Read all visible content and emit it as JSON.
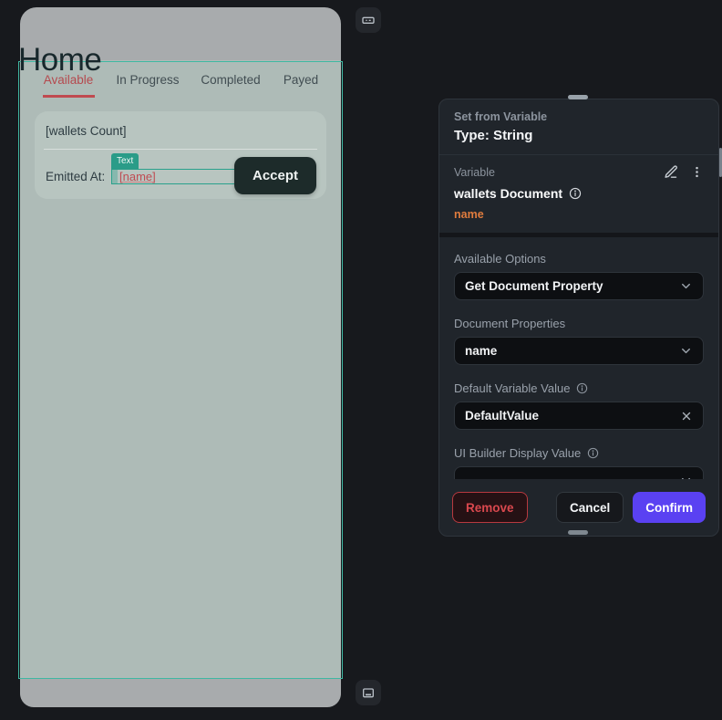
{
  "phone_preview": {
    "page_title": "Home",
    "tabs": [
      {
        "label": "Available",
        "active": true
      },
      {
        "label": "In Progress",
        "active": false
      },
      {
        "label": "Completed",
        "active": false
      },
      {
        "label": "Payed",
        "active": false
      }
    ],
    "card": {
      "count_text": "[wallets Count]",
      "emitted_label": "Emitted At:",
      "selection_badge": "Text",
      "selected_text_value": "[name]",
      "accept_button": "Accept"
    }
  },
  "canvas_toolbar": {
    "top_button_icon": "keyboard-icon",
    "bottom_button_icon": "dock-bottom-icon"
  },
  "panel": {
    "header": {
      "title": "Set from Variable",
      "subtitle": "Type: String"
    },
    "variable": {
      "label": "Variable",
      "name": "wallets Document",
      "property": "name",
      "icons": [
        "edit-pencil-icon",
        "kebab-menu-icon",
        "info-icon"
      ]
    },
    "groups": [
      {
        "label": "Available Options",
        "value": "Get Document Property",
        "type": "select",
        "info": false
      },
      {
        "label": "Document Properties",
        "value": "name",
        "type": "select",
        "info": false
      },
      {
        "label": "Default Variable Value",
        "value": "DefaultValue",
        "type": "input",
        "info": true
      },
      {
        "label": "UI Builder Display Value",
        "value": "",
        "type": "select",
        "info": true
      }
    ],
    "footer": {
      "remove": "Remove",
      "cancel": "Cancel",
      "confirm": "Confirm"
    }
  },
  "colors": {
    "page_bg": "#17191d",
    "phone_bar": "#a8abad",
    "phone_body": "#aebbb7",
    "card_bg": "#b8c5c0",
    "selection_teal": "#2aa18c",
    "tab_active_red": "#b5494e",
    "accept_dark": "#1d2b2a",
    "panel_bg": "#20252b",
    "control_bg": "#0d0f12",
    "variable_orange": "#e07c3e",
    "remove_red": "#d9484e",
    "confirm_purple": "#5a41f2"
  }
}
